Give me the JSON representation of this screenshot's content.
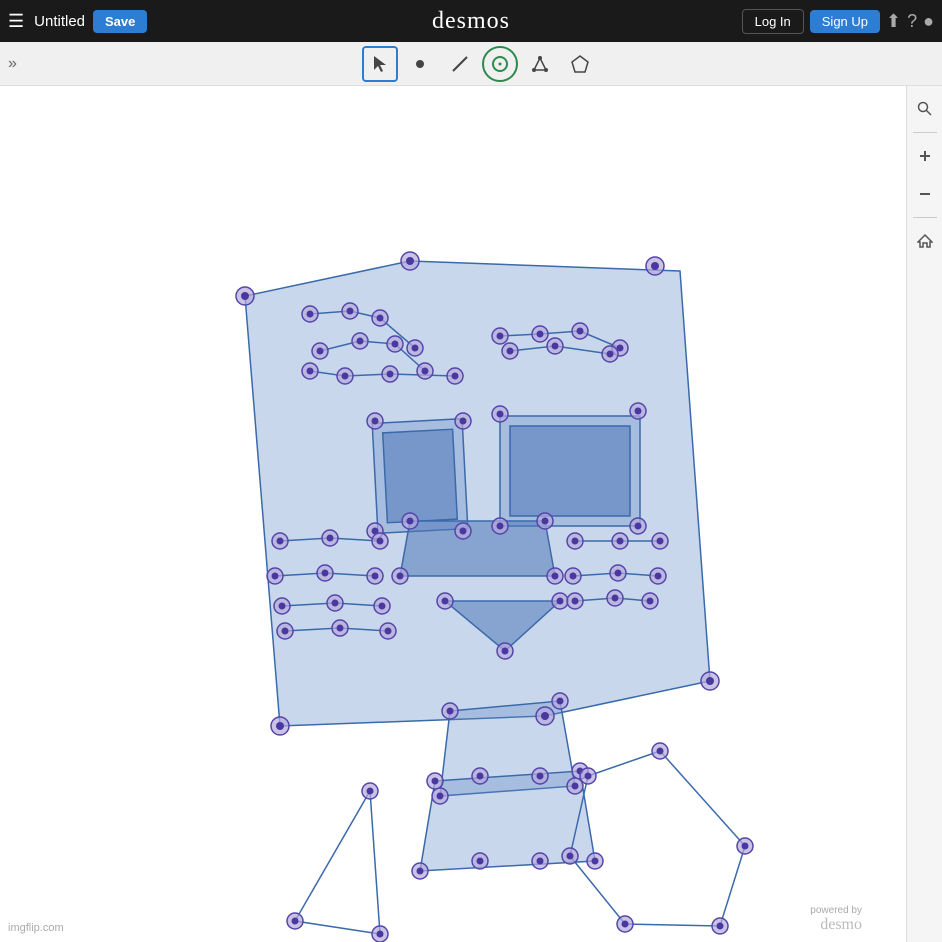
{
  "topbar": {
    "menu_label": "☰",
    "title": "Untitled",
    "save_label": "Save",
    "logo": "desmos",
    "login_label": "Log In",
    "signup_label": "Sign Up",
    "share_icon": "⬆",
    "help_icon": "?",
    "account_icon": "👤"
  },
  "toolbar": {
    "expand_label": "»",
    "tools": [
      {
        "name": "select",
        "icon": "↖",
        "active": true
      },
      {
        "name": "point",
        "icon": "•",
        "active": false
      },
      {
        "name": "line",
        "icon": "/",
        "active": false
      },
      {
        "name": "circle",
        "icon": "○",
        "active": false
      },
      {
        "name": "triangle",
        "icon": "△",
        "active": false
      },
      {
        "name": "polygon",
        "icon": "⬡",
        "active": false
      }
    ]
  },
  "right_panel": {
    "search_icon": "🔍",
    "zoom_in_icon": "+",
    "zoom_out_icon": "−",
    "home_icon": "⌂"
  },
  "watermark": {
    "powered": "powered by",
    "logo": "desmo"
  },
  "imgflip": {
    "label": "imgflip.com"
  }
}
